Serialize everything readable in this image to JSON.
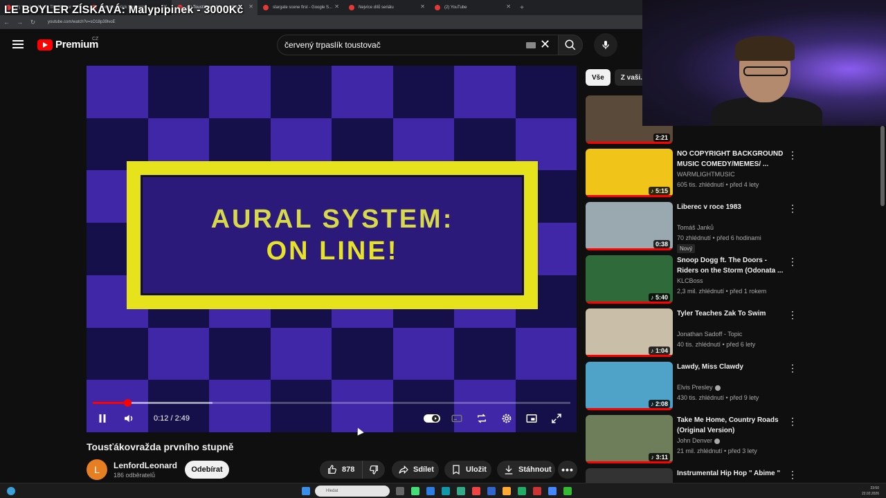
{
  "stream_title": "LE BOYLER ZÍSKÁVÁ: Malypipinek - 3000Kč",
  "browser": {
    "tabs": [
      {
        "label": "(2) You Led Me To The Winner",
        "active": false
      },
      {
        "label": "Bourne – Kick Streaming",
        "active": false
      },
      {
        "label": "(2) Tousťákovražda prvního...",
        "active": true
      },
      {
        "label": "stargate scene first - Google S...",
        "active": false
      },
      {
        "label": "Nejvíce dílů seriálu",
        "active": false
      },
      {
        "label": "(2) YouTube",
        "active": false
      }
    ],
    "url": "youtube.com/watch?v=sO18p39lvoE"
  },
  "header": {
    "logo_text": "Premium",
    "region": "CZ",
    "search_value": "červený trpaslík toustovač"
  },
  "video": {
    "sign_line1": "AURAL SYSTEM:",
    "sign_line2": "ON LINE!",
    "time": "0:12 / 2:49",
    "played_fraction": 0.072,
    "buffered_fraction": 0.25,
    "title": "Tousťákovražda prvního stupně",
    "channel": "LenfordLeonard",
    "channel_initial": "L",
    "subscribers": "186 odběratelů",
    "subscribe_label": "Odebírat",
    "likes": "878",
    "share_label": "Sdílet",
    "save_label": "Uložit",
    "download_label": "Stáhnout"
  },
  "sidebar": {
    "chips": [
      "Vše",
      "Z vaši..."
    ],
    "items": [
      {
        "title": "",
        "channel": "",
        "meta": "",
        "duration": "2:21",
        "music": false,
        "badge": "",
        "thumb": "#5a4a3a"
      },
      {
        "title": "NO COPYRIGHT BACKGROUND MUSIC COMEDY/MEMES/ ...",
        "channel": "WARMLIGHTMUSIC",
        "meta": "605 tis. zhlédnutí • před 4 lety",
        "duration": "5:15",
        "music": true,
        "badge": "",
        "thumb": "#f0c419"
      },
      {
        "title": "Liberec v roce 1983",
        "channel": "Tomáš Janků",
        "meta": "70 zhlédnutí • před 6 hodinami",
        "duration": "0:38",
        "music": false,
        "badge": "Nový",
        "thumb": "#9aa8b0"
      },
      {
        "title": "Snoop Dogg ft. The Doors - Riders on the Storm (Odonata ...",
        "channel": "KLCBoss",
        "meta": "2,3 mil. zhlédnutí • před 1 rokem",
        "duration": "5:40",
        "music": true,
        "badge": "",
        "thumb": "#2f6a3a"
      },
      {
        "title": "Tyler Teaches Zak To Swim",
        "channel": "Jonathan Sadoff - Topic",
        "meta": "40 tis. zhlédnutí • před 6 lety",
        "duration": "1:04",
        "music": true,
        "badge": "",
        "thumb": "#c9bfa8"
      },
      {
        "title": "Lawdy, Miss Clawdy",
        "channel": "Elvis Presley",
        "meta": "430 tis. zhlédnutí • před 9 lety",
        "duration": "2:08",
        "music": true,
        "badge": "",
        "thumb": "#4fa3c8",
        "verified": true
      },
      {
        "title": "Take Me Home, Country Roads (Original Version)",
        "channel": "John Denver",
        "meta": "21 mil. zhlédnutí • před 3 lety",
        "duration": "3:11",
        "music": true,
        "badge": "",
        "thumb": "#6e7d5a",
        "verified": true
      },
      {
        "title": "Instrumental Hip Hop \" Abime \" ...",
        "channel": "",
        "meta": "",
        "duration": "",
        "music": false,
        "badge": "",
        "thumb": "#333"
      }
    ]
  },
  "taskbar": {
    "search_placeholder": "Hledat",
    "time": "23:50",
    "date": "22.02.2026"
  },
  "colors": {
    "accent": "#ff0000",
    "background": "#0f0f0f",
    "sign_yellow": "#e6e21b"
  }
}
